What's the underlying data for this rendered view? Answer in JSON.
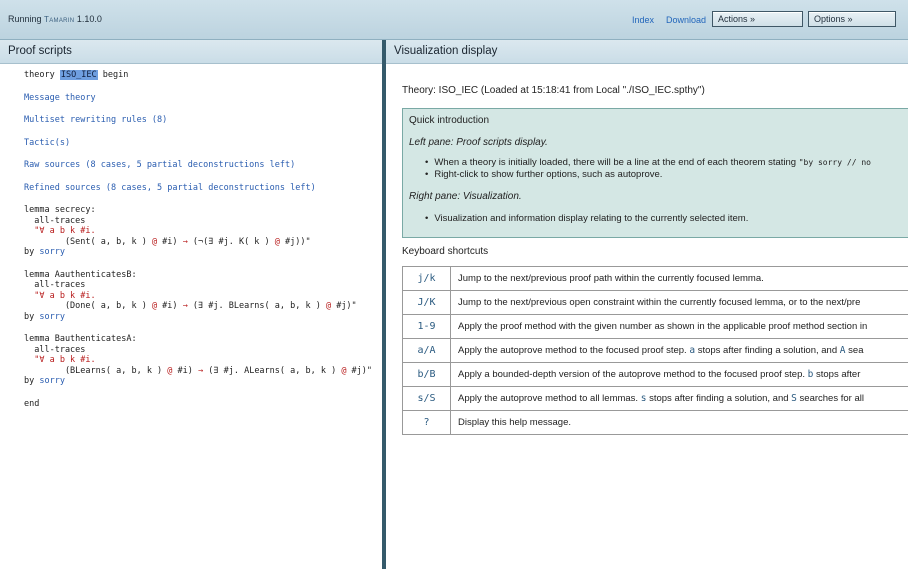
{
  "topbar": {
    "running_prefix": "Running",
    "brand": "Tamarin",
    "version": "1.10.0",
    "index_link": "Index",
    "download_link": "Download",
    "actions_button": "Actions »",
    "options_button": "Options »"
  },
  "left": {
    "header": "Proof scripts",
    "theory_prefix": "theory ",
    "theory_name": "ISO_IEC",
    "theory_suffix": " begin",
    "links": {
      "message_theory": "Message theory",
      "multiset_rules": "Multiset rewriting rules (8)",
      "tactic": "Tactic(s)",
      "raw_sources": "Raw sources (8 cases, 5 partial deconstructions left)",
      "refined_sources": "Refined sources (8 cases, 5 partial deconstructions left)"
    },
    "lemmas": [
      {
        "name_line": "lemma secrecy:",
        "traces": "  all-traces",
        "quant": "  \"∀ a b k #i.",
        "body_pre": "        (Sent( a, b, k ) ",
        "at1": "@",
        "body_mid1": " #i) ",
        "arrow": "→",
        "body_mid2": " (¬(∃ #j. K( k ) ",
        "at2": "@",
        "body_end": " #j))\"",
        "by": "by ",
        "sorry": "sorry"
      },
      {
        "name_line": "lemma AauthenticatesB:",
        "traces": "  all-traces",
        "quant": "  \"∀ a b k #i.",
        "body_pre": "        (Done( a, b, k ) ",
        "at1": "@",
        "body_mid1": " #i) ",
        "arrow": "→",
        "body_mid2": " (∃ #j. BLearns( a, b, k ) ",
        "at2": "@",
        "body_end": " #j)\"",
        "by": "by ",
        "sorry": "sorry"
      },
      {
        "name_line": "lemma BauthenticatesA:",
        "traces": "  all-traces",
        "quant": "  \"∀ a b k #i.",
        "body_pre": "        (BLearns( a, b, k ) ",
        "at1": "@",
        "body_mid1": " #i) ",
        "arrow": "→",
        "body_mid2": " (∃ #j. ALearns( a, b, k ) ",
        "at2": "@",
        "body_end": " #j)\"",
        "by": "by ",
        "sorry": "sorry"
      }
    ],
    "end": "end"
  },
  "right": {
    "header": "Visualization display",
    "theory_line": "Theory: ISO_IEC (Loaded at 15:18:41 from Local \"./ISO_IEC.spthy\")",
    "quick_intro": {
      "title": "Quick introduction",
      "left_heading": "Left pane: Proof scripts display.",
      "left_b1_text": "When a theory is initially loaded, there will be a line at the end of each theorem stating ",
      "left_b1_code": "\"by sorry // no",
      "left_b2": "Right-click to show further options, such as autoprove.",
      "right_heading": "Right pane: Visualization.",
      "right_b1": "Visualization and information display relating to the currently selected item."
    },
    "keyboard_title": "Keyboard shortcuts",
    "shortcuts": [
      {
        "key": "j/k",
        "desc": "Jump to the next/previous proof path within the currently focused lemma."
      },
      {
        "key": "J/K",
        "desc": "Jump to the next/previous open constraint within the currently focused lemma, or to the next/pre"
      },
      {
        "key": "1-9",
        "desc": "Apply the proof method with the given number as shown in the applicable proof method section in"
      },
      {
        "key": "a/A",
        "d1": "Apply the autoprove method to the focused proof step. ",
        "k1": "a",
        "d2": " stops after finding a solution, and ",
        "k2": "A",
        "d3": " sea"
      },
      {
        "key": "b/B",
        "d1": "Apply a bounded-depth version of the autoprove method to the focused proof step. ",
        "k1": "b",
        "d2": " stops after"
      },
      {
        "key": "s/S",
        "d1": "Apply the autoprove method to all lemmas. ",
        "k1": "s",
        "d2": " stops after finding a solution, and ",
        "k2": "S",
        "d3": " searches for all"
      },
      {
        "key": "?",
        "desc": "Display this help message."
      }
    ]
  }
}
